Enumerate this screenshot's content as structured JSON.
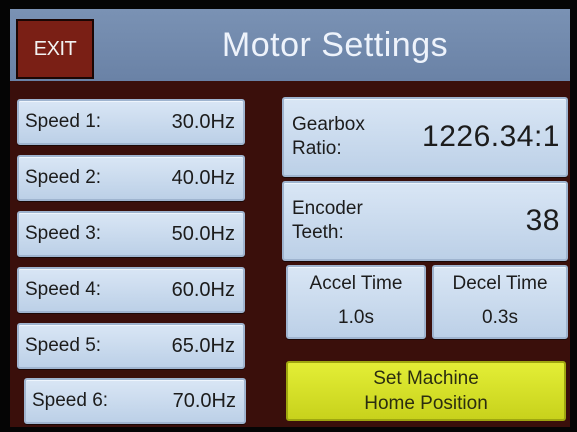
{
  "header": {
    "exit_label": "EXIT",
    "title": "Motor Settings"
  },
  "speeds": [
    {
      "label": "Speed 1:",
      "value": "30.0Hz"
    },
    {
      "label": "Speed 2:",
      "value": "40.0Hz"
    },
    {
      "label": "Speed 3:",
      "value": "50.0Hz"
    },
    {
      "label": "Speed 4:",
      "value": "60.0Hz"
    },
    {
      "label": "Speed 5:",
      "value": "65.0Hz"
    },
    {
      "label": "Speed 6:",
      "value": "70.0Hz"
    }
  ],
  "gearbox": {
    "label_line1": "Gearbox",
    "label_line2": "Ratio:",
    "value": "1226.34:1"
  },
  "encoder": {
    "label_line1": "Encoder",
    "label_line2": "Teeth:",
    "value": "38"
  },
  "accel": {
    "label": "Accel Time",
    "value": "1.0s"
  },
  "decel": {
    "label": "Decel Time",
    "value": "0.3s"
  },
  "home": {
    "line1": "Set Machine",
    "line2": "Home Position"
  },
  "colors": {
    "background": "#3a0f0b",
    "titlebar": "#6a82a6",
    "exit_button": "#7a1f15",
    "button": "#c9dbef",
    "home_button": "#d6e028"
  }
}
